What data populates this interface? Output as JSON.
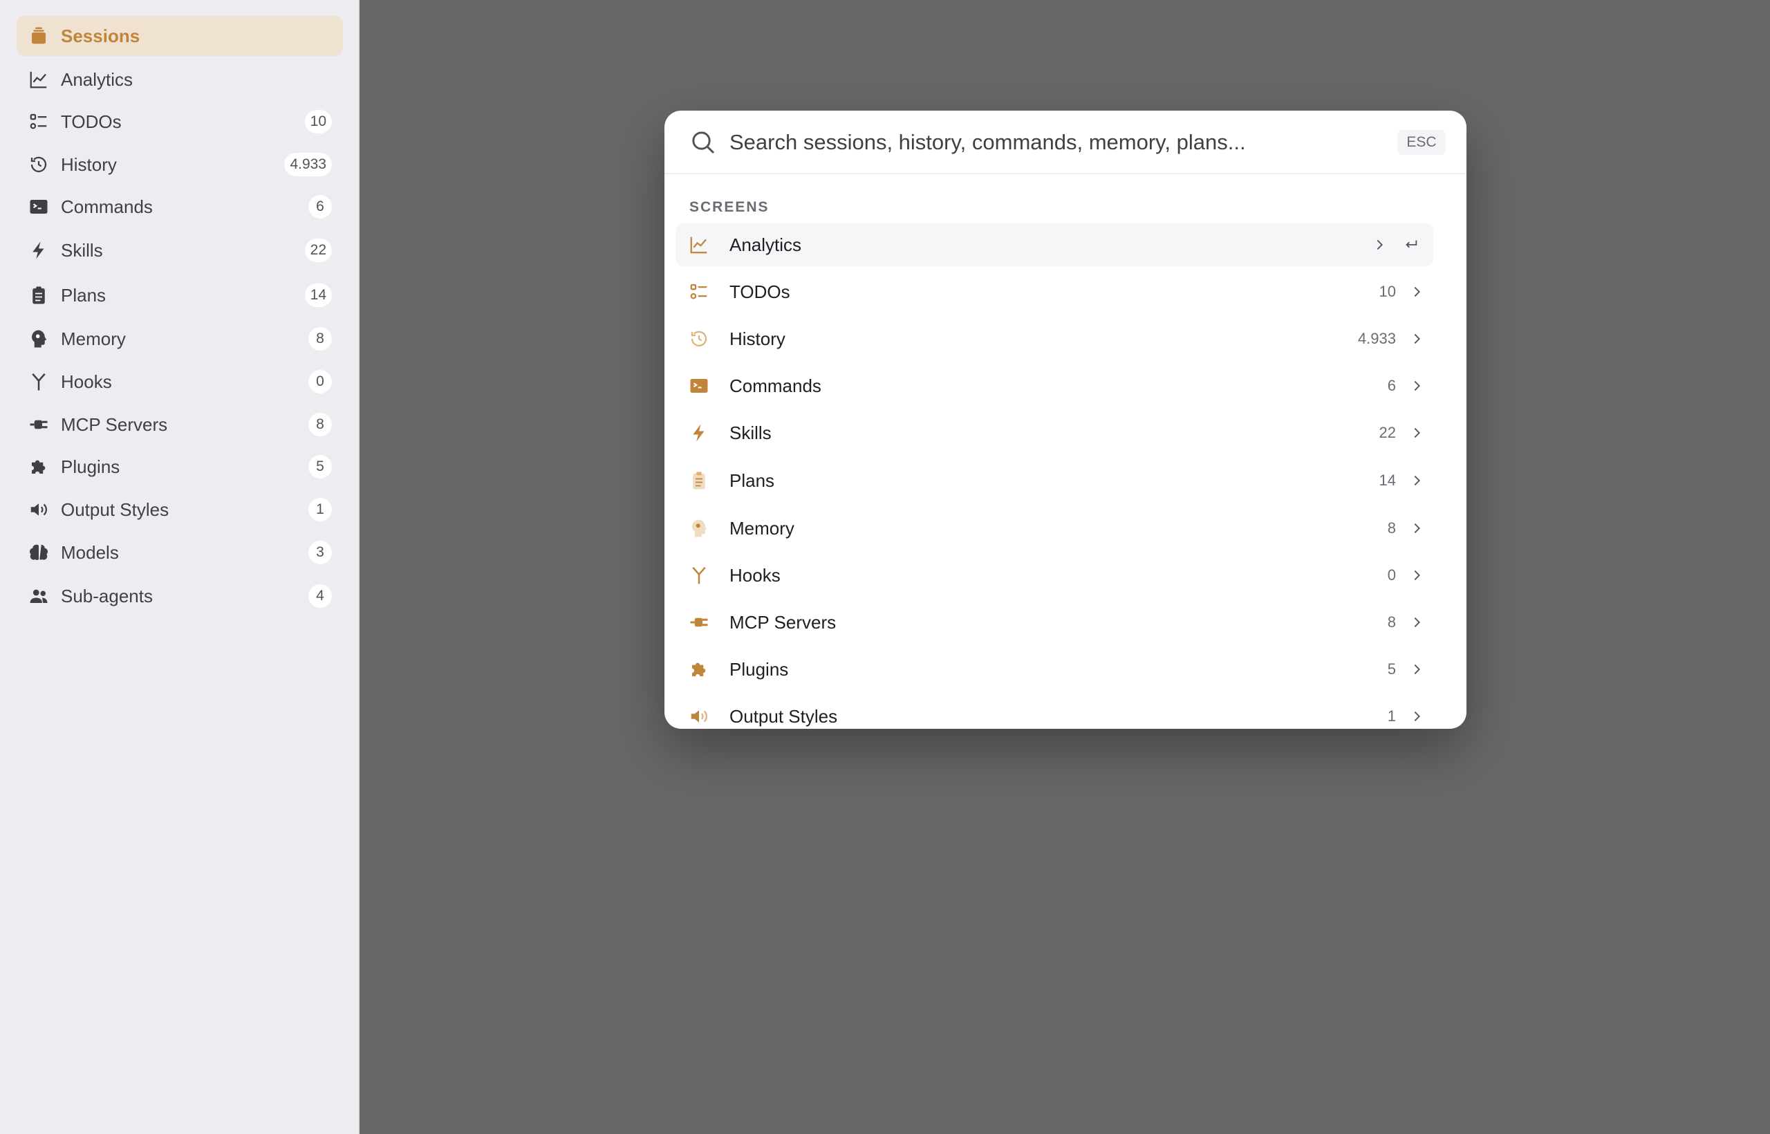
{
  "sidebar": {
    "items": [
      {
        "label": "Sessions",
        "badge": "",
        "icon": "sessions-icon"
      },
      {
        "label": "Analytics",
        "badge": "",
        "icon": "analytics-icon"
      },
      {
        "label": "TODOs",
        "badge": "10",
        "icon": "todos-icon"
      },
      {
        "label": "History",
        "badge": "4.933",
        "icon": "history-icon"
      },
      {
        "label": "Commands",
        "badge": "6",
        "icon": "commands-icon"
      },
      {
        "label": "Skills",
        "badge": "22",
        "icon": "skills-icon"
      },
      {
        "label": "Plans",
        "badge": "14",
        "icon": "plans-icon"
      },
      {
        "label": "Memory",
        "badge": "8",
        "icon": "memory-icon"
      },
      {
        "label": "Hooks",
        "badge": "0",
        "icon": "hooks-icon"
      },
      {
        "label": "MCP Servers",
        "badge": "8",
        "icon": "mcp-servers-icon"
      },
      {
        "label": "Plugins",
        "badge": "5",
        "icon": "plugins-icon"
      },
      {
        "label": "Output Styles",
        "badge": "1",
        "icon": "output-styles-icon"
      },
      {
        "label": "Models",
        "badge": "3",
        "icon": "models-icon"
      },
      {
        "label": "Sub-agents",
        "badge": "4",
        "icon": "sub-agents-icon"
      }
    ]
  },
  "palette": {
    "search": {
      "placeholder": "Search sessions, history, commands, memory, plans...",
      "value": ""
    },
    "esc_label": "ESC",
    "section_label": "SCREENS",
    "items": [
      {
        "label": "Analytics",
        "count": "",
        "icon": "analytics-icon"
      },
      {
        "label": "TODOs",
        "count": "10",
        "icon": "todos-icon"
      },
      {
        "label": "History",
        "count": "4.933",
        "icon": "history-icon"
      },
      {
        "label": "Commands",
        "count": "6",
        "icon": "commands-icon"
      },
      {
        "label": "Skills",
        "count": "22",
        "icon": "skills-icon"
      },
      {
        "label": "Plans",
        "count": "14",
        "icon": "plans-icon"
      },
      {
        "label": "Memory",
        "count": "8",
        "icon": "memory-icon"
      },
      {
        "label": "Hooks",
        "count": "0",
        "icon": "hooks-icon"
      },
      {
        "label": "MCP Servers",
        "count": "8",
        "icon": "mcp-servers-icon"
      },
      {
        "label": "Plugins",
        "count": "5",
        "icon": "plugins-icon"
      },
      {
        "label": "Output Styles",
        "count": "1",
        "icon": "output-styles-icon"
      }
    ]
  },
  "colors": {
    "accent": "#c0843a",
    "active_bg": "#f0e2d1",
    "sidebar_bg": "#ececf1",
    "overlay": "#686868"
  }
}
